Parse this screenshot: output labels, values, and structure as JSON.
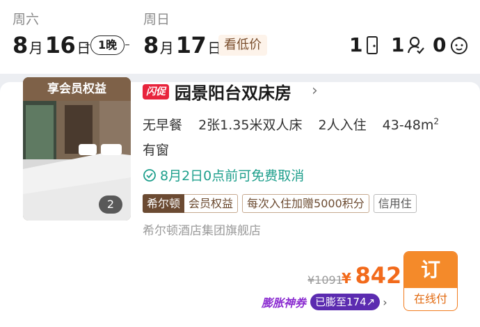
{
  "checkin": {
    "weekday": "周六",
    "month": "8",
    "month_unit": "月",
    "day": "16",
    "day_unit": "日"
  },
  "checkout": {
    "weekday": "周日",
    "month": "8",
    "month_unit": "月",
    "day": "17",
    "day_unit": "日"
  },
  "nights": "1晚",
  "low_price_label": "看低价",
  "occupancy": {
    "rooms": "1",
    "adults": "1",
    "children": "0"
  },
  "room": {
    "member_banner": "享会员权益",
    "photo_count": "2",
    "flash_badge": "闪促",
    "title": "园景阳台双床房",
    "chevron": "›",
    "amenities": [
      "无早餐",
      "2张1.35米双人床",
      "2人入住",
      "43-48m"
    ],
    "area_sup": "2",
    "window": "有窗",
    "cancel_policy": "8月2日0点前可免费取消",
    "brand_tag": "希尔顿",
    "member_tag": "会员权益",
    "points_tag": "每次入住加赠5000积分",
    "credit_tag": "信用住",
    "store": "希尔顿酒店集团旗舰店"
  },
  "price": {
    "original": "¥1091",
    "currency": "¥",
    "current": "842"
  },
  "coupon": {
    "label": "膨胀神券",
    "pill": "已膨至174",
    "arrow": "↗",
    "chev": "›"
  },
  "book_button": {
    "label": "订",
    "sub": "在线付"
  },
  "colors": {
    "accent": "#f26a1b",
    "teal": "#1e9f8c",
    "purple": "#5b2bb0",
    "flash": "#e8243c",
    "brown": "#6b4a32"
  }
}
